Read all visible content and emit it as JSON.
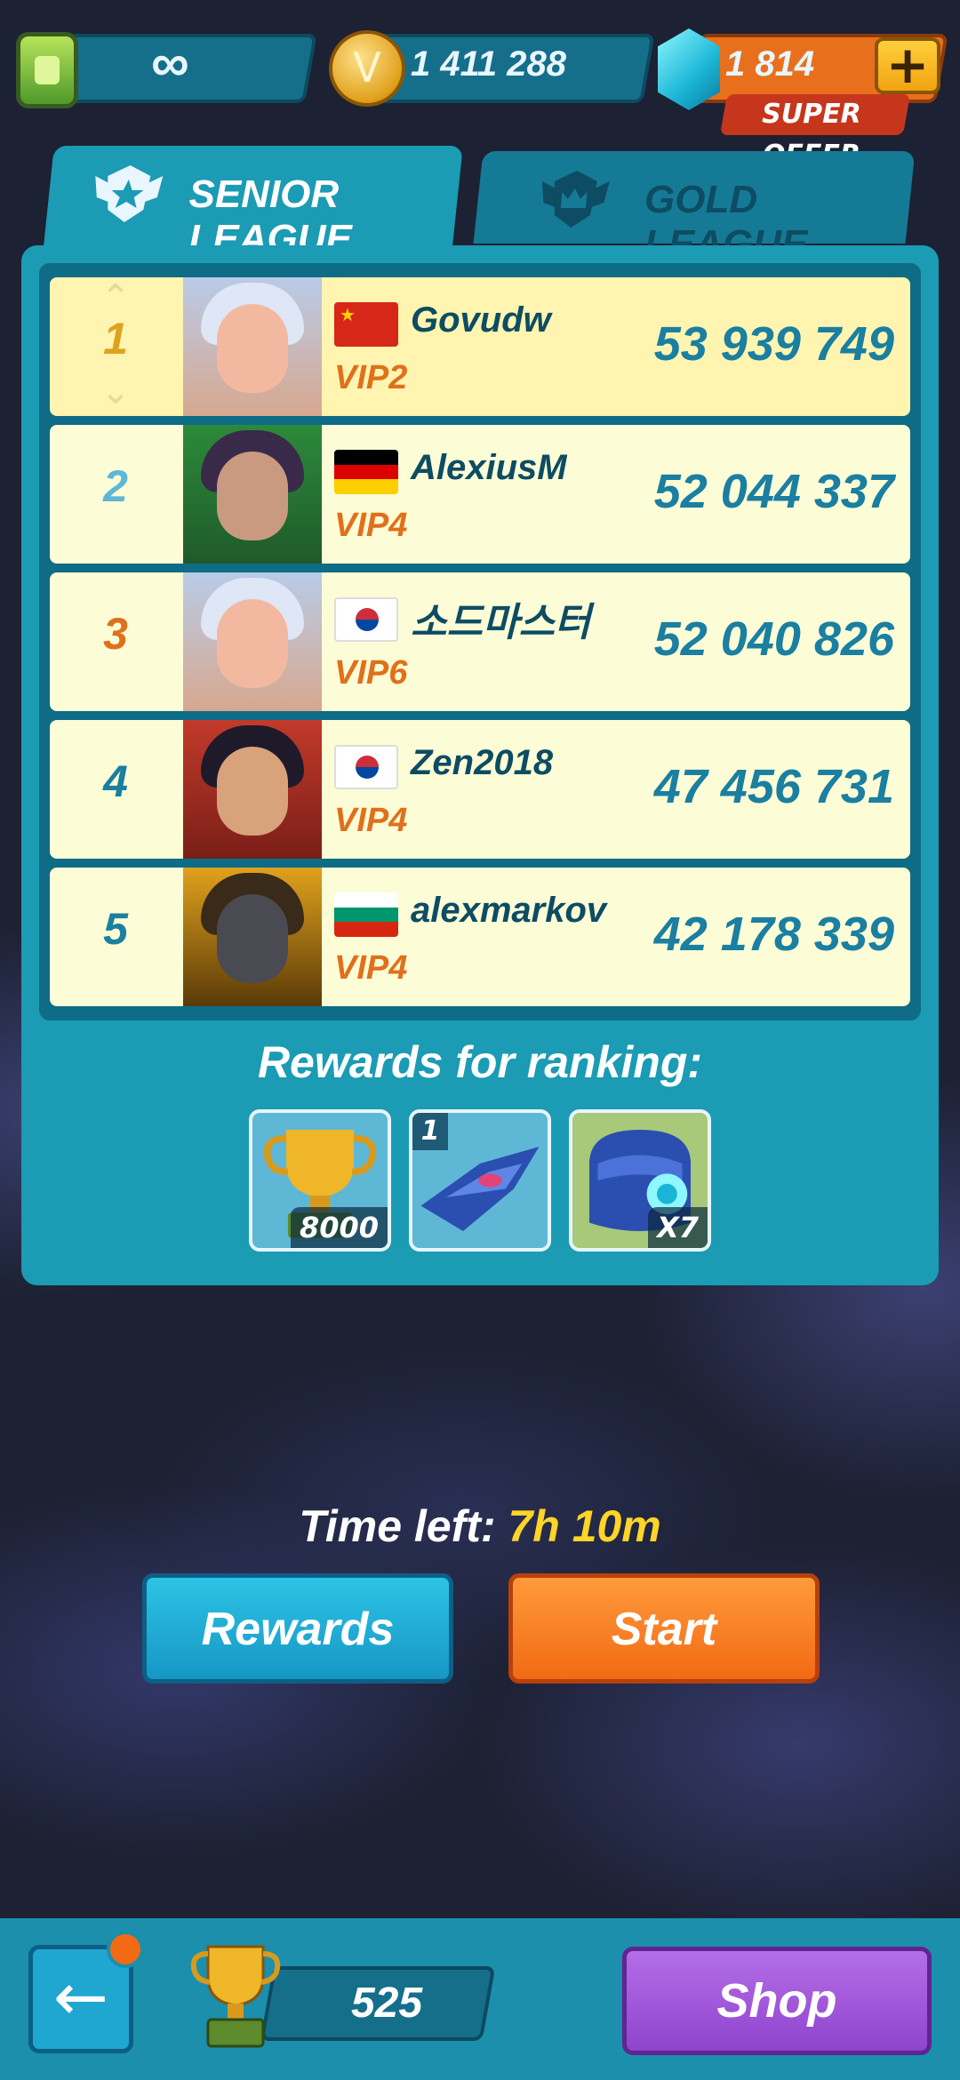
{
  "topbar": {
    "energy": "∞",
    "coins": "1 411 288",
    "gems": "1 814",
    "super_offer": "SUPER OFFER",
    "plus": "+"
  },
  "tabs": [
    {
      "label": "SENIOR LEAGUE",
      "active": true
    },
    {
      "label": "GOLD LEAGUE",
      "active": false
    }
  ],
  "leaderboard": [
    {
      "rank": "1",
      "name": "Govudw",
      "vip": "VIP2",
      "score": "53 939 749",
      "flag": "china-flag"
    },
    {
      "rank": "2",
      "name": "AlexiusM",
      "vip": "VIP4",
      "score": "52 044 337",
      "flag": "germany-flag"
    },
    {
      "rank": "3",
      "name": "소드마스터",
      "vip": "VIP6",
      "score": "52 040 826",
      "flag": "south-korea-flag"
    },
    {
      "rank": "4",
      "name": "Zen2018",
      "vip": "VIP4",
      "score": "47 456 731",
      "flag": "south-korea-flag"
    },
    {
      "rank": "5",
      "name": "alexmarkov",
      "vip": "VIP4",
      "score": "42 178 339",
      "flag": "bulgaria-flag"
    }
  ],
  "rank_colors": {
    "1": "#e0a11c",
    "2": "#5fb7d6",
    "3": "#e0701b",
    "4": "#1a7fa0",
    "5": "#1a7fa0"
  },
  "rewards": {
    "title": "Rewards for ranking:",
    "items": [
      {
        "icon": "trophy-icon",
        "count": "8000"
      },
      {
        "icon": "spaceship-icon",
        "tag": "1"
      },
      {
        "icon": "helmet-chest-icon",
        "count": "X7"
      }
    ]
  },
  "timer": {
    "label": "Time left:",
    "value": "7h 10m"
  },
  "buttons": {
    "rewards": "Rewards",
    "start": "Start",
    "shop": "Shop",
    "back": "←"
  },
  "bottom": {
    "trophies": "525"
  }
}
